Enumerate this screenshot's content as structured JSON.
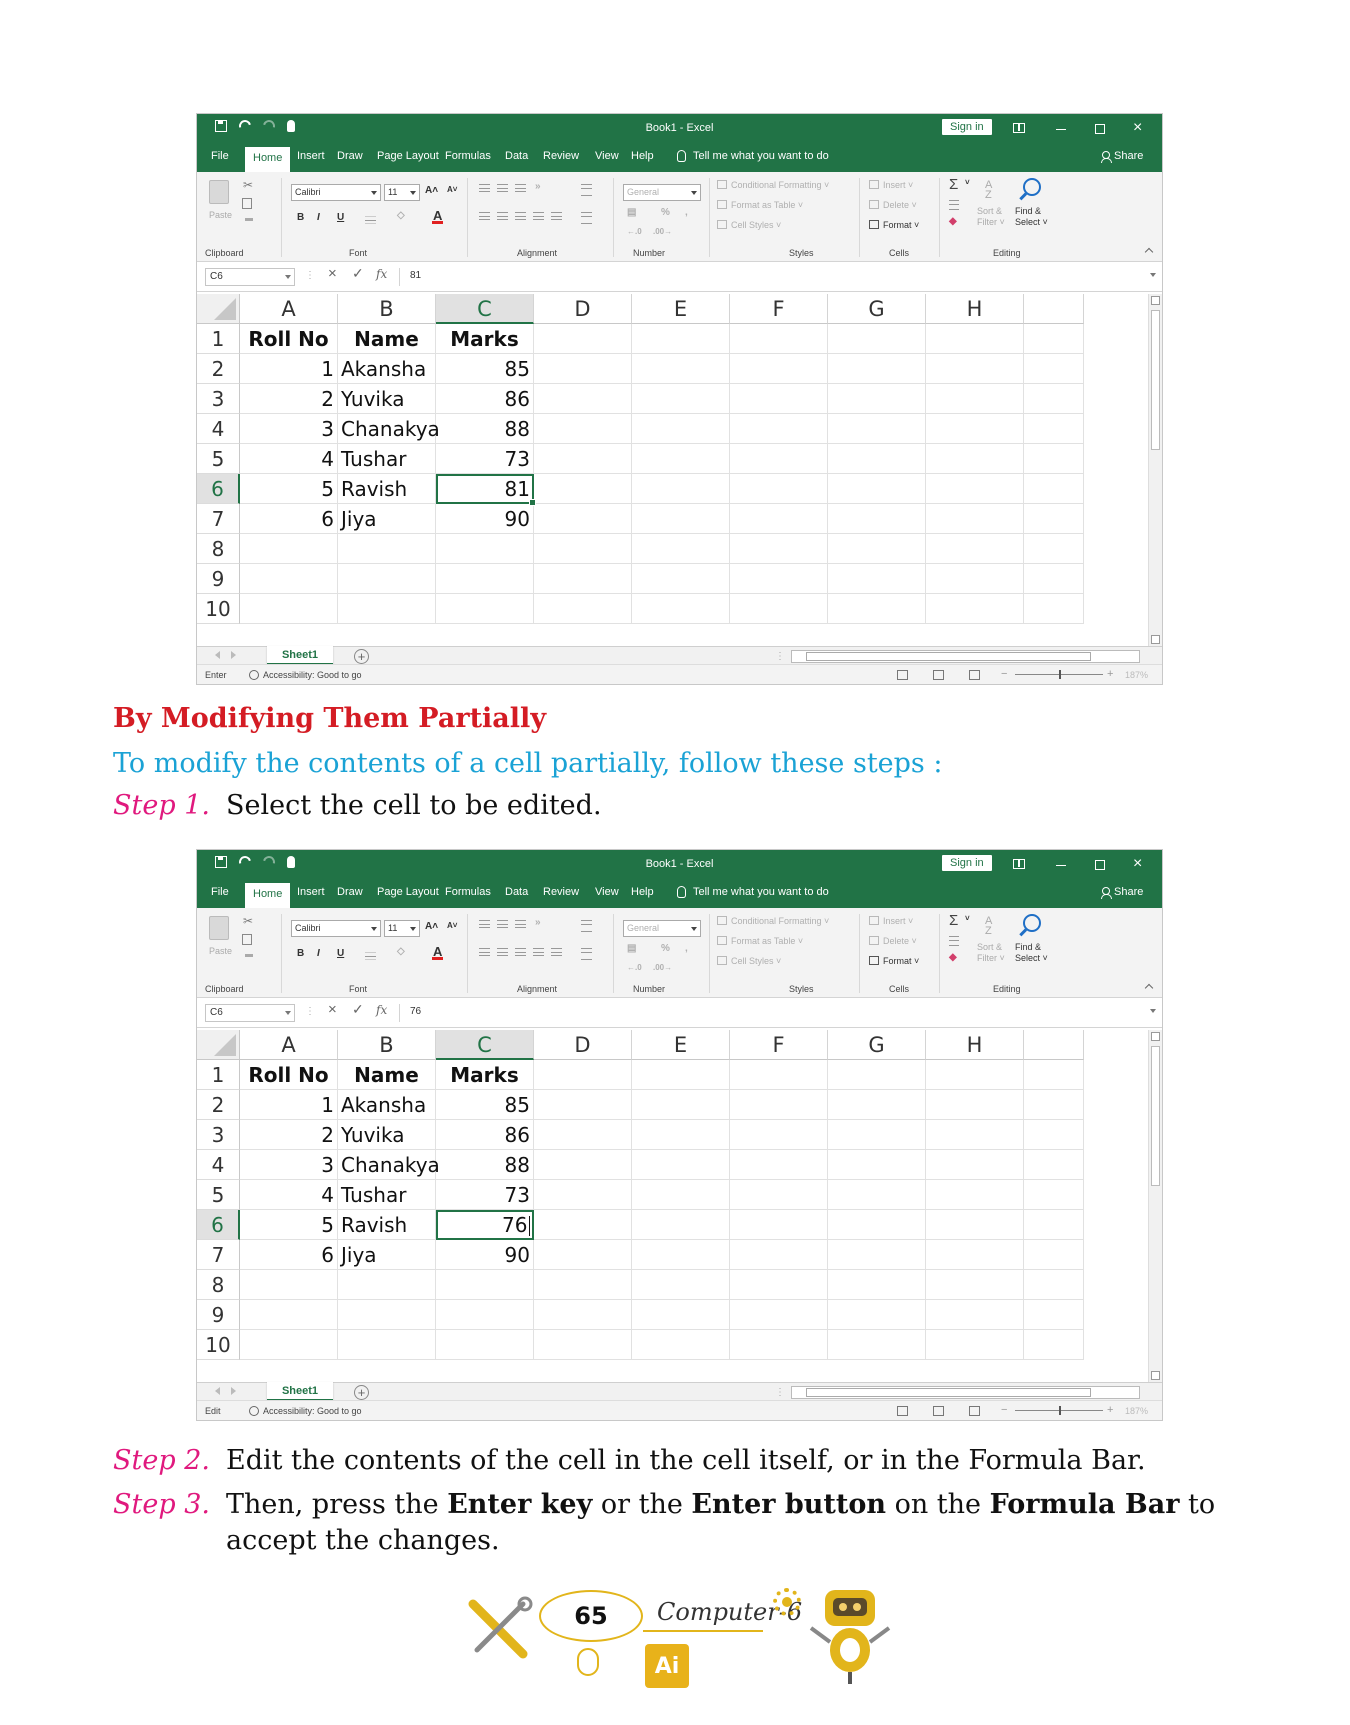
{
  "excel": {
    "window_title": "Book1  -  Excel",
    "signin_label": "Sign in",
    "tabs": [
      "File",
      "Home",
      "Insert",
      "Draw",
      "Page Layout",
      "Formulas",
      "Data",
      "Review",
      "View",
      "Help"
    ],
    "active_tab": "Home",
    "tell_me": "Tell me what you want to do",
    "share_label": "Share",
    "ribbon": {
      "paste": "Paste",
      "clipboard": "Clipboard",
      "font_name": "Calibri",
      "font_size": "11",
      "bold": "B",
      "italic": "I",
      "underline": "U",
      "font": "Font",
      "alignment": "Alignment",
      "number_format": "General",
      "percent": "%",
      "number": "Number",
      "conditional_formatting": "Conditional Formatting",
      "format_as_table": "Format as Table",
      "cell_styles": "Cell Styles",
      "styles": "Styles",
      "insert": "Insert",
      "delete": "Delete",
      "format": "Format",
      "cells": "Cells",
      "sort_filter_1": "Sort &",
      "sort_filter_2": "Filter",
      "find_select_1": "Find &",
      "find_select_2": "Select",
      "editing": "Editing"
    },
    "columns": [
      "A",
      "B",
      "C",
      "D",
      "E",
      "F",
      "G",
      "H"
    ],
    "rows": [
      "1",
      "2",
      "3",
      "4",
      "5",
      "6",
      "7",
      "8",
      "9",
      "10"
    ],
    "sheet_tab": "Sheet1",
    "accessibility": "Accessibility: Good to go",
    "zoom": "187%",
    "table": {
      "headers": [
        "Roll No",
        "Name",
        "Marks"
      ],
      "roll": [
        "1",
        "2",
        "3",
        "4",
        "5",
        "6"
      ],
      "names": [
        "Akansha",
        "Yuvika",
        "Chanakya",
        "Tushar",
        "Ravish",
        "Jiya"
      ],
      "marks_before": [
        "85",
        "86",
        "88",
        "73",
        "81",
        "90"
      ],
      "marks_after": [
        "85",
        "86",
        "88",
        "73",
        "76",
        "90"
      ]
    },
    "shot1": {
      "namebox": "C6",
      "formula": "81",
      "mode": "Enter"
    },
    "shot2": {
      "namebox": "C6",
      "formula": "76",
      "mode": "Edit"
    }
  },
  "content": {
    "heading": "By Modifying Them Partially",
    "intro": "To modify the contents of a cell partially, follow these steps :",
    "step1_label": "Step 1.",
    "step1_text": "Select the cell to be edited.",
    "step2_label": "Step 2.",
    "step2_text": "Edit the contents of the cell in the cell itself, or in the Formula Bar.",
    "step3_label": "Step 3.",
    "step3_t1": "Then, press the ",
    "step3_b1": "Enter key",
    "step3_t2": " or the ",
    "step3_b2": "Enter button",
    "step3_t3": " on the ",
    "step3_b3": "Formula Bar",
    "step3_t4": " to accept the changes."
  },
  "footer": {
    "page_number": "65",
    "book_title": "Computer-6",
    "chip_label": "Ai"
  },
  "colors": {
    "excel_green": "#217346",
    "heading_red": "#d41c24",
    "intro_blue": "#1aa2d5",
    "step_magenta": "#e0197e",
    "footer_gold": "#e2b51b"
  }
}
